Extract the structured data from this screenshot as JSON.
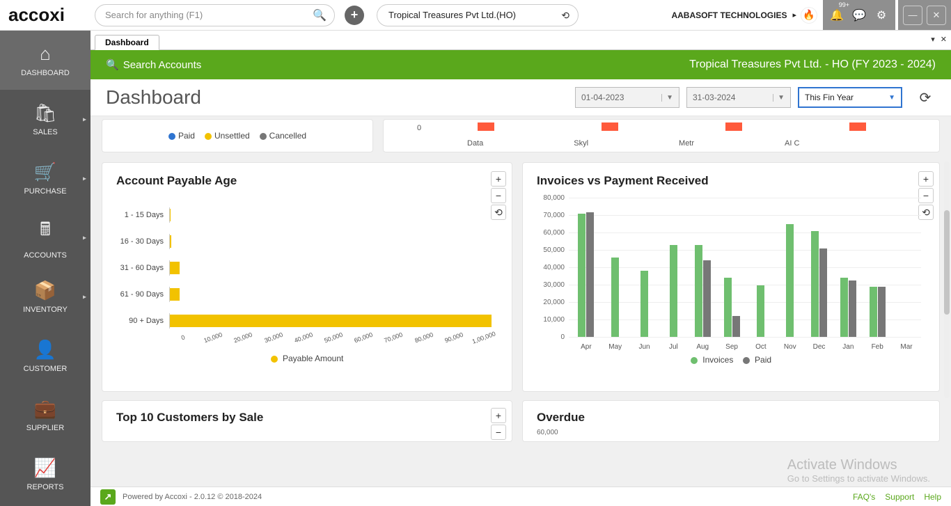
{
  "header": {
    "logo_text": "accoxi",
    "search_placeholder": "Search for anything (F1)",
    "company_name": "Tropical Treasures Pvt Ltd.(HO)",
    "tenant_name": "AABASOFT TECHNOLOGIES",
    "notification_badge": "99+"
  },
  "nav": {
    "items": [
      {
        "label": "DASHBOARD",
        "icon": "⌂",
        "active": true,
        "chev": false
      },
      {
        "label": "SALES",
        "icon": "🛍",
        "active": false,
        "chev": true
      },
      {
        "label": "PURCHASE",
        "icon": "🛒",
        "active": false,
        "chev": true
      },
      {
        "label": "ACCOUNTS",
        "icon": "🖩",
        "active": false,
        "chev": true
      },
      {
        "label": "INVENTORY",
        "icon": "📦",
        "active": false,
        "chev": true
      },
      {
        "label": "CUSTOMER",
        "icon": "👤",
        "active": false,
        "chev": false
      },
      {
        "label": "SUPPLIER",
        "icon": "💼",
        "active": false,
        "chev": false
      },
      {
        "label": "REPORTS",
        "icon": "📈",
        "active": false,
        "chev": false
      }
    ]
  },
  "tab": {
    "label": "Dashboard"
  },
  "greenbar": {
    "search_accounts": "Search Accounts",
    "context": "Tropical Treasures Pvt Ltd. - HO (FY 2023 - 2024)"
  },
  "dashhead": {
    "title": "Dashboard",
    "date_from": "01-04-2023",
    "date_to": "31-03-2024",
    "range_label": "This Fin Year"
  },
  "top_left_legend": {
    "paid": "Paid",
    "unsettled": "Unsettled",
    "cancelled": "Cancelled",
    "paid_color": "#2f74d0",
    "unsettled_color": "#f2c200",
    "cancelled_color": "#777"
  },
  "top_right_chart": {
    "ylabel_zero": "0",
    "categories": [
      "Data",
      "Skyl",
      "Metr",
      "AI C"
    ]
  },
  "chart_data": [
    {
      "id": "account_payable_age",
      "type": "bar",
      "orientation": "horizontal",
      "title": "Account Payable Age",
      "legend": "Payable Amount",
      "legend_color": "#f2c200",
      "categories": [
        "1 - 15 Days",
        "16 - 30 Days",
        "31 - 60 Days",
        "61 - 90 Days",
        "90 + Days"
      ],
      "values": [
        300,
        500,
        3000,
        3000,
        98000
      ],
      "xlim": [
        0,
        100000
      ],
      "xticks": [
        "0",
        "10,000",
        "20,000",
        "30,000",
        "40,000",
        "50,000",
        "60,000",
        "70,000",
        "80,000",
        "90,000",
        "1,00,000"
      ]
    },
    {
      "id": "invoices_vs_payment",
      "type": "bar",
      "title": "Invoices vs Payment Received",
      "categories": [
        "Apr",
        "May",
        "Jun",
        "Jul",
        "Aug",
        "Sep",
        "Oct",
        "Nov",
        "Dec",
        "Jan",
        "Feb",
        "Mar"
      ],
      "series": [
        {
          "name": "Invoices",
          "color": "#6fbf6f",
          "values": [
            71000,
            45500,
            38000,
            53000,
            53000,
            34000,
            29500,
            65000,
            61000,
            34000,
            29000,
            0
          ]
        },
        {
          "name": "Paid",
          "color": "#777777",
          "values": [
            71500,
            0,
            0,
            0,
            44000,
            12000,
            0,
            0,
            51000,
            32500,
            29000,
            0
          ]
        }
      ],
      "ylim": [
        0,
        80000
      ],
      "yticks": [
        "0",
        "10,000",
        "20,000",
        "30,000",
        "40,000",
        "50,000",
        "60,000",
        "70,000",
        "80,000"
      ]
    },
    {
      "id": "top_partial",
      "type": "bar",
      "categories": [
        "Data",
        "Skyl",
        "Metr",
        "AI C"
      ],
      "values": [
        1,
        1,
        1,
        1
      ],
      "color": "#ff5a3c",
      "ylabel_zero": "0"
    }
  ],
  "bottom": {
    "top10_title": "Top 10 Customers by Sale",
    "overdue_title": "Overdue",
    "overdue_first_tick": "60,000"
  },
  "footer": {
    "powered": "Powered by Accoxi - 2.0.12 © 2018-2024",
    "links": [
      "FAQ's",
      "Support",
      "Help"
    ]
  },
  "watermark": {
    "line1": "Activate Windows",
    "line2": "Go to Settings to activate Windows."
  }
}
